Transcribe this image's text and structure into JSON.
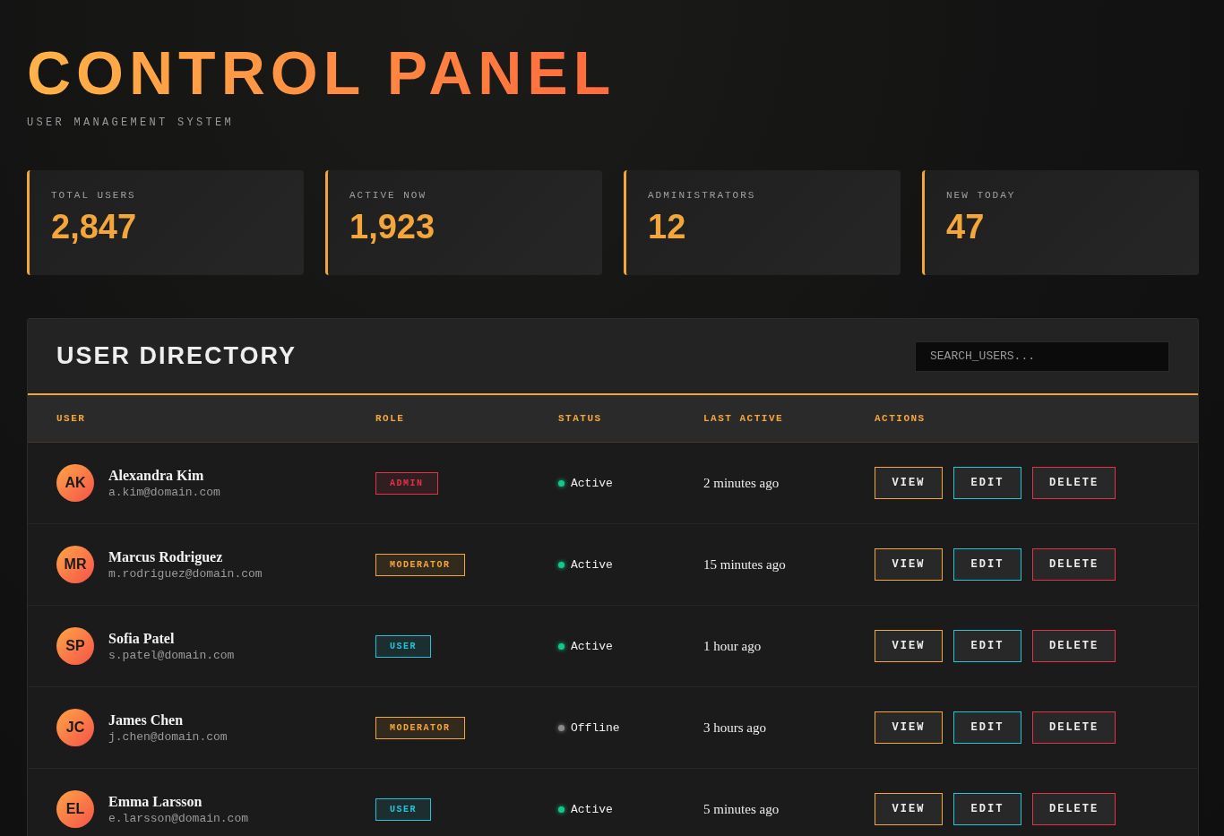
{
  "header": {
    "title": "CONTROL PANEL",
    "subtitle": "USER MANAGEMENT SYSTEM"
  },
  "stats": [
    {
      "label": "TOTAL USERS",
      "value": "2,847"
    },
    {
      "label": "ACTIVE NOW",
      "value": "1,923"
    },
    {
      "label": "ADMINISTRATORS",
      "value": "12"
    },
    {
      "label": "NEW TODAY",
      "value": "47"
    }
  ],
  "directory": {
    "title": "USER DIRECTORY",
    "search": {
      "placeholder": "SEARCH_USERS..."
    },
    "columns": [
      "USER",
      "ROLE",
      "STATUS",
      "LAST ACTIVE",
      "ACTIONS"
    ],
    "rows": [
      {
        "initials": "AK",
        "name": "Alexandra Kim",
        "email": "a.kim@domain.com",
        "role": {
          "label": "ADMIN",
          "color": "#e0334a"
        },
        "status": {
          "label": "Active",
          "color": "#10c98f"
        },
        "last_active": "2 minutes ago",
        "actions": [
          {
            "label": "VIEW",
            "color": "#f5a63a"
          },
          {
            "label": "EDIT",
            "color": "#22c5d8"
          },
          {
            "label": "DELETE",
            "color": "#e0334a"
          }
        ]
      },
      {
        "initials": "MR",
        "name": "Marcus Rodriguez",
        "email": "m.rodriguez@domain.com",
        "role": {
          "label": "MODERATOR",
          "color": "#f5a63a"
        },
        "status": {
          "label": "Active",
          "color": "#10c98f"
        },
        "last_active": "15 minutes ago",
        "actions": [
          {
            "label": "VIEW",
            "color": "#f5a63a"
          },
          {
            "label": "EDIT",
            "color": "#22c5d8"
          },
          {
            "label": "DELETE",
            "color": "#e0334a"
          }
        ]
      },
      {
        "initials": "SP",
        "name": "Sofia Patel",
        "email": "s.patel@domain.com",
        "role": {
          "label": "USER",
          "color": "#22c5d8"
        },
        "status": {
          "label": "Active",
          "color": "#10c98f"
        },
        "last_active": "1 hour ago",
        "actions": [
          {
            "label": "VIEW",
            "color": "#f5a63a"
          },
          {
            "label": "EDIT",
            "color": "#22c5d8"
          },
          {
            "label": "DELETE",
            "color": "#e0334a"
          }
        ]
      },
      {
        "initials": "JC",
        "name": "James Chen",
        "email": "j.chen@domain.com",
        "role": {
          "label": "MODERATOR",
          "color": "#f5a63a"
        },
        "status": {
          "label": "Offline",
          "color": "#8a8a8a"
        },
        "last_active": "3 hours ago",
        "actions": [
          {
            "label": "VIEW",
            "color": "#f5a63a"
          },
          {
            "label": "EDIT",
            "color": "#22c5d8"
          },
          {
            "label": "DELETE",
            "color": "#e0334a"
          }
        ]
      },
      {
        "initials": "EL",
        "name": "Emma Larsson",
        "email": "e.larsson@domain.com",
        "role": {
          "label": "USER",
          "color": "#22c5d8"
        },
        "status": {
          "label": "Active",
          "color": "#10c98f"
        },
        "last_active": "5 minutes ago",
        "actions": [
          {
            "label": "VIEW",
            "color": "#f5a63a"
          },
          {
            "label": "EDIT",
            "color": "#22c5d8"
          },
          {
            "label": "DELETE",
            "color": "#e0334a"
          }
        ]
      }
    ]
  }
}
